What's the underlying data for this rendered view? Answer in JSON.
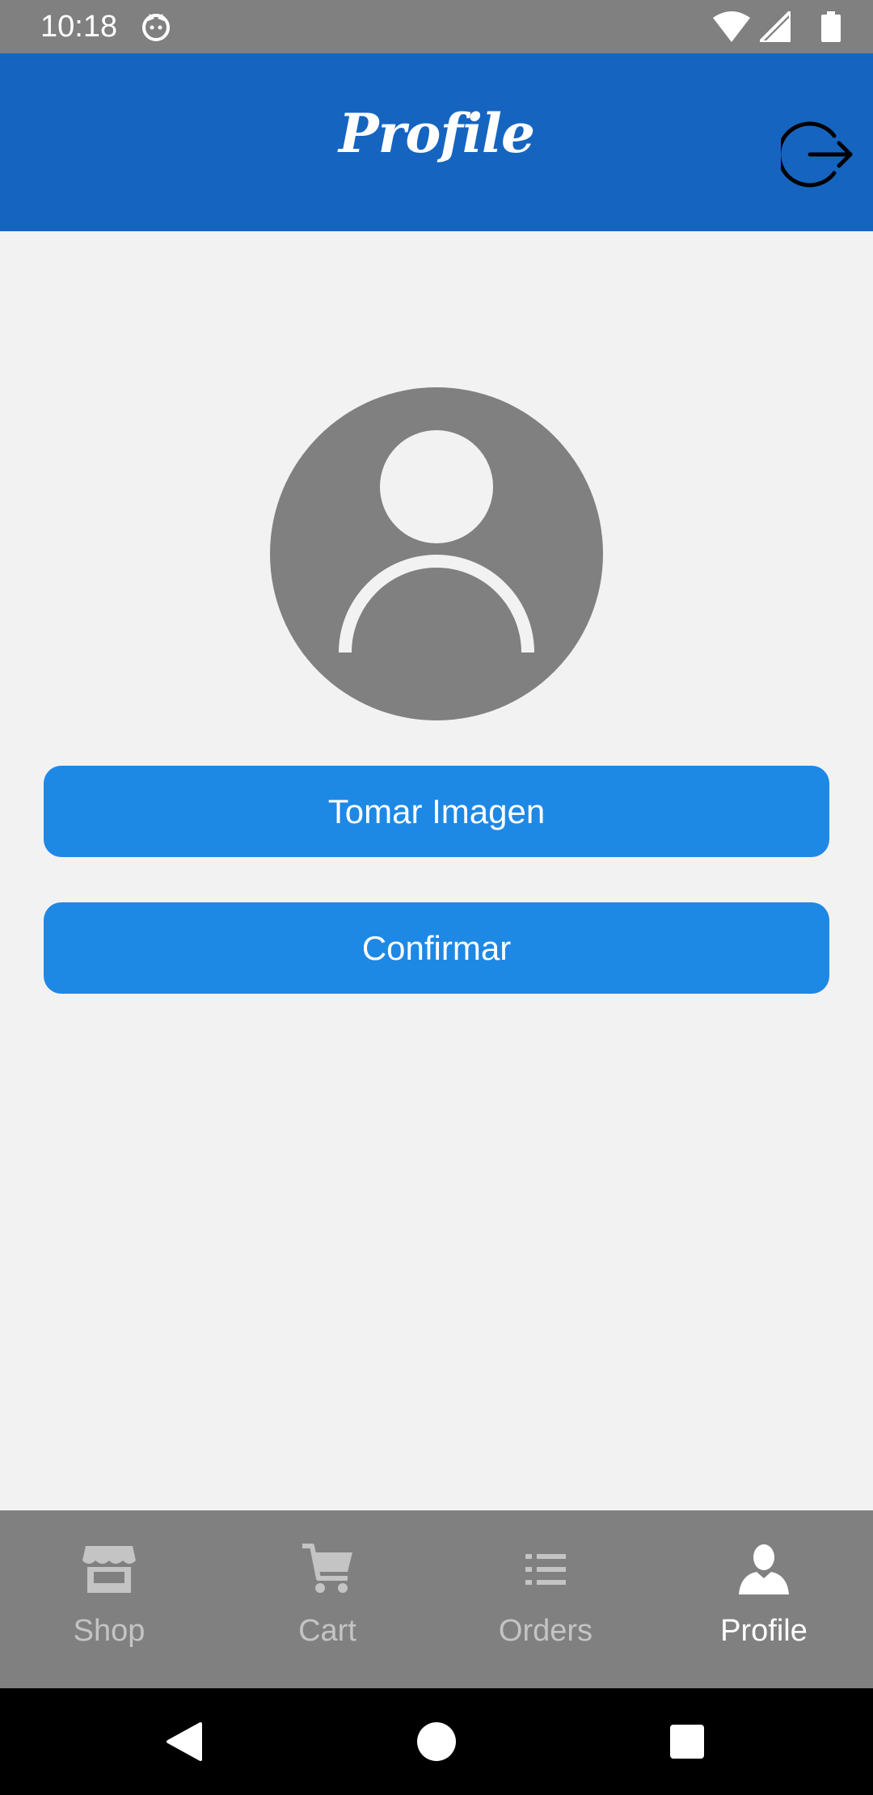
{
  "status_bar": {
    "time": "10:18",
    "icons": [
      "cat-notification-icon",
      "wifi-icon",
      "signal-icon",
      "battery-icon"
    ]
  },
  "app_bar": {
    "title": "Profile",
    "action_icon": "logout-icon"
  },
  "profile": {
    "avatar_icon": "person-placeholder-icon",
    "take_image_label": "Tomar Imagen",
    "confirm_label": "Confirmar"
  },
  "bottom_nav": {
    "items": [
      {
        "label": "Shop",
        "icon": "store-icon",
        "active": false
      },
      {
        "label": "Cart",
        "icon": "cart-icon",
        "active": false
      },
      {
        "label": "Orders",
        "icon": "list-icon",
        "active": false
      },
      {
        "label": "Profile",
        "icon": "person-icon",
        "active": true
      }
    ]
  },
  "colors": {
    "app_bar": "#1565c0",
    "button": "#1e88e5",
    "background": "#f2f2f2",
    "bars": "#808080",
    "inactive_nav": "#c4c4c4",
    "active_nav": "#ffffff"
  }
}
